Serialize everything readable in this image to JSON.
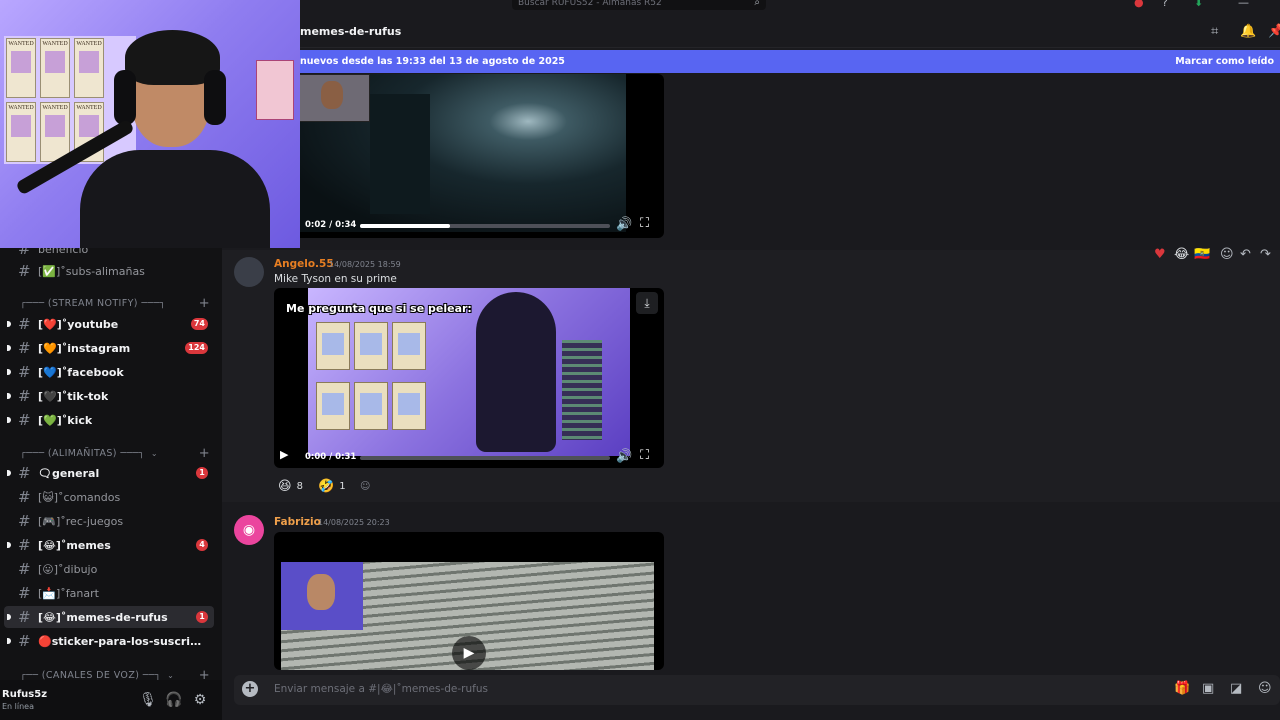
{
  "colors": {
    "accent": "#5865f2",
    "badge": "#da373c",
    "author_orange": "#e67e22",
    "author_fabrizio": "#f0a04b"
  },
  "search": {
    "placeholder": "Buscar RUFUS52 - Almañas R52"
  },
  "header": {
    "channel": "memes-de-rufus"
  },
  "newbar": {
    "text": "nuevos desde las 19:33 del 13 de agosto de 2025",
    "mark": "Marcar como leído"
  },
  "sidebar": {
    "partial_top": "beneficio",
    "channels_top": [
      {
        "label": "[✅]˚subs-alimañas"
      }
    ],
    "categories": {
      "stream_notify": "┌─── (STREAM NOTIFY) ───┐",
      "alimanitas": "┌─── (ALIMAÑITAS) ───┐",
      "voz": "┌── (CANALES DE VOZ) ──┐"
    },
    "stream_channels": [
      {
        "label": "[❤️]˚youtube",
        "badge": "74"
      },
      {
        "label": "[🧡]˚instagram",
        "badge": "124"
      },
      {
        "label": "[💙]˚facebook",
        "badge": ""
      },
      {
        "label": "[🖤]˚tik-tok",
        "badge": ""
      },
      {
        "label": "[💚]˚kick",
        "badge": ""
      }
    ],
    "alim_channels": [
      {
        "label": "🗨general",
        "badge": "1",
        "unread": true
      },
      {
        "label": "[😺]˚comandos",
        "badge": "",
        "unread": false
      },
      {
        "label": "[🎮]˚rec-juegos",
        "badge": "",
        "unread": false
      },
      {
        "label": "[😂]˚memes",
        "badge": "4",
        "unread": true
      },
      {
        "label": "[😛]˚dibujo",
        "badge": "",
        "unread": false
      },
      {
        "label": "[📩]˚fanart",
        "badge": "",
        "unread": false
      },
      {
        "label": "[😂]˚memes-de-rufus",
        "badge": "1",
        "unread": true
      },
      {
        "label": "🔴sticker-para-los-suscritores-...",
        "badge": "",
        "unread": true
      }
    ]
  },
  "user": {
    "name": "Rufus5z",
    "status": "En línea"
  },
  "videos": {
    "v1": {
      "time": "0:02 / 0:34",
      "progress": 0.36
    },
    "v2": {
      "time": "0:00 / 0:31",
      "progress": 0.0,
      "caption": "Me pregunta que si se pelear:"
    }
  },
  "messages": [
    {
      "author": "Angelo.55",
      "timestamp": "14/08/2025 18:59",
      "text": "Mike Tyson en su prime",
      "reactions": [
        {
          "emoji": "😆",
          "count": "8"
        },
        {
          "emoji": "🤣",
          "count": "1"
        }
      ]
    },
    {
      "author": "Fabrizio",
      "timestamp": "14/08/2025 20:23",
      "text": ""
    }
  ],
  "composer": {
    "placeholder": "Enviar mensaje a #|😂|˚memes-de-rufus"
  }
}
